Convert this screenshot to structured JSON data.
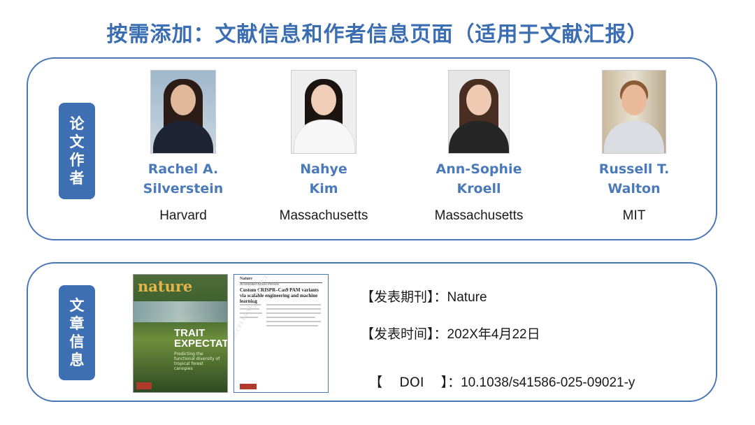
{
  "page_title": "按需添加：文献信息和作者信息页面（适用于文献汇报）",
  "sections": {
    "authors_tab": "论文作者",
    "article_tab": "文章信息"
  },
  "authors": [
    {
      "name_line1": "Rachel A.",
      "name_line2": "Silverstein",
      "affiliation": "Harvard"
    },
    {
      "name_line1": "Nahye",
      "name_line2": "Kim",
      "affiliation": "Massachusetts"
    },
    {
      "name_line1": "Ann-Sophie",
      "name_line2": "Kroell",
      "affiliation": "Massachusetts"
    },
    {
      "name_line1": "Russell T.",
      "name_line2": "Walton",
      "affiliation": "MIT"
    }
  ],
  "cover": {
    "logo": "nature",
    "headline": "TRAIT EXPECTATIONS",
    "subtitle": "Predicting the functional diversity of tropical forest canopies"
  },
  "paper": {
    "journal": "Nature",
    "category": "Accelerated Article Preview",
    "title": "Custom CRISPR–Cas9 PAM variants via scalable engineering and machine learning",
    "watermark": "ACCELERATED ARTICLE PREVIEW"
  },
  "info": {
    "journal_label": "【发表期刊】：",
    "journal_value": "Nature",
    "date_label": "【发表时间】：",
    "date_value": "202X年4月22日",
    "doi_label": "【    DOI    】：",
    "doi_value": "10.1038/s41586-025-09021-y"
  },
  "colors": {
    "accent": "#3a6db1",
    "tab_bg": "#3f6fb3",
    "name_text": "#4a7ab9"
  }
}
